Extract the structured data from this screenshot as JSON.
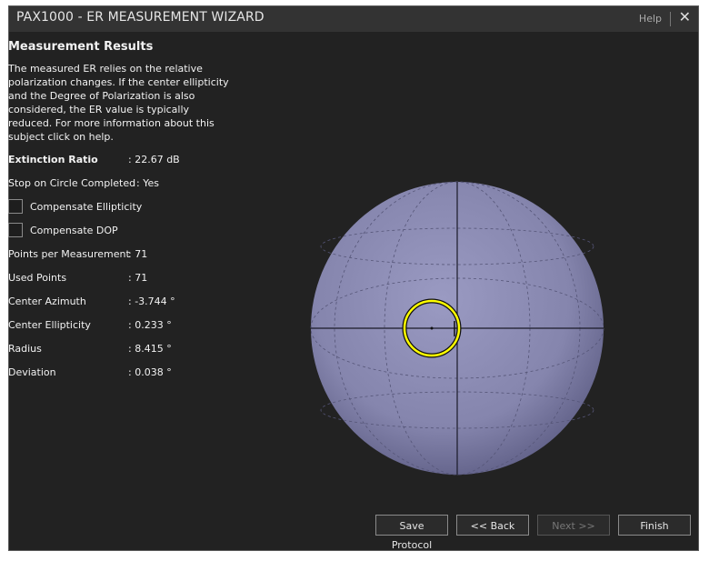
{
  "window": {
    "title": "PAX1000 - ER MEASUREMENT WIZARD",
    "help_label": "Help",
    "close_glyph": "✕"
  },
  "results": {
    "heading": "Measurement Results",
    "description": "The measured ER relies on the relative polarization changes. If the center ellipticity and the Degree of Polarization is also considered, the ER value is typically reduced. For more information about this subject click on help.",
    "extinction_ratio": {
      "label": "Extinction Ratio",
      "value": ": 22.67 dB"
    },
    "stop_on_circle": {
      "label": "Stop on Circle Completed",
      "value": ": Yes"
    },
    "compensate_ellipticity": {
      "label": "Compensate Ellipticity",
      "checked": false
    },
    "compensate_dop": {
      "label": "Compensate DOP",
      "checked": false
    },
    "points_per_measurement": {
      "label": "Points per Measurement",
      "value": ": 71"
    },
    "used_points": {
      "label": "Used Points",
      "value": ": 71"
    },
    "center_azimuth": {
      "label": "Center Azimuth",
      "value": ": -3.744 °"
    },
    "center_ellipticity": {
      "label": "Center Ellipticity",
      "value": ": 0.233 °"
    },
    "radius": {
      "label": "Radius",
      "value": ": 8.415 °"
    },
    "deviation": {
      "label": "Deviation",
      "value": ": 0.038 °"
    }
  },
  "buttons": {
    "save_protocol": "Save Protocol",
    "back": "<< Back",
    "next": "Next >>",
    "finish": "Finish"
  },
  "colors": {
    "sphere": "#8c8cb4",
    "circle_trace": "#ffff00",
    "background": "#222222"
  },
  "icons": {
    "close": "close-icon",
    "checkbox": "checkbox-icon"
  }
}
